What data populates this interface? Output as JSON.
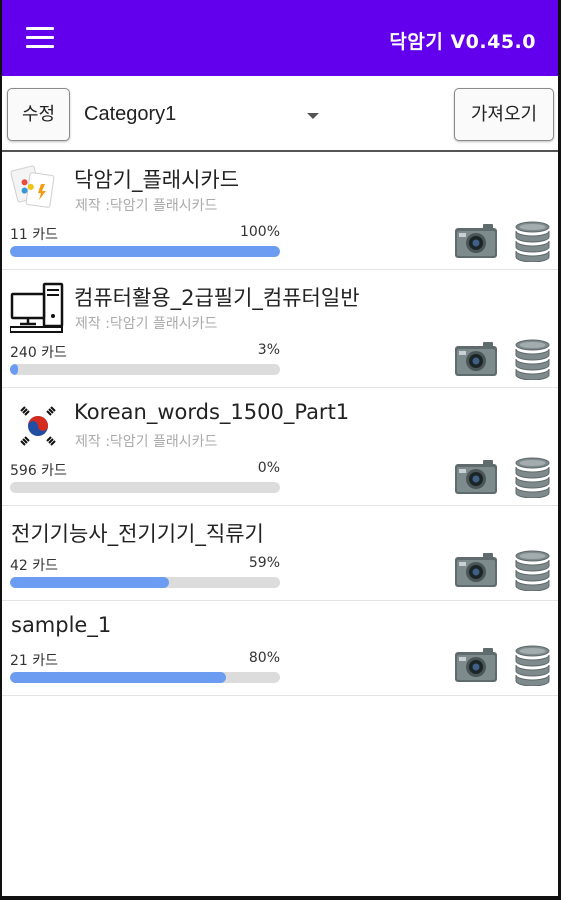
{
  "app": {
    "title": "닥암기 V0.45.0",
    "accent_color": "#6200ee",
    "progress_color": "#6b9cf2",
    "menu_icon": "hamburger-menu-icon"
  },
  "toolbar": {
    "edit_label": "수정",
    "category_value": "Category1",
    "import_label": "가져오기"
  },
  "decks": [
    {
      "title": "닥암기_플래시카드",
      "maker": "제작 :닥암기 플래시카드",
      "count": "11 카드",
      "percent": "100%",
      "progress": 1.0,
      "icon": "flashcards-icon"
    },
    {
      "title": "컴퓨터활용_2급필기_컴퓨터일반",
      "maker": "제작 :닥암기 플래시카드",
      "count": "240 카드",
      "percent": "3%",
      "progress": 0.03,
      "icon": "computer-icon"
    },
    {
      "title": "Korean_words_1500_Part1",
      "maker": "제작 :닥암기 플래시카드",
      "count": "596 카드",
      "percent": "0%",
      "progress": 0.0,
      "icon": "korea-flag-icon"
    },
    {
      "title": "전기기능사_전기기기_직류기",
      "count": "42 카드",
      "percent": "59%",
      "progress": 0.59
    },
    {
      "title": "sample_1",
      "count": "21 카드",
      "percent": "80%",
      "progress": 0.8
    }
  ]
}
